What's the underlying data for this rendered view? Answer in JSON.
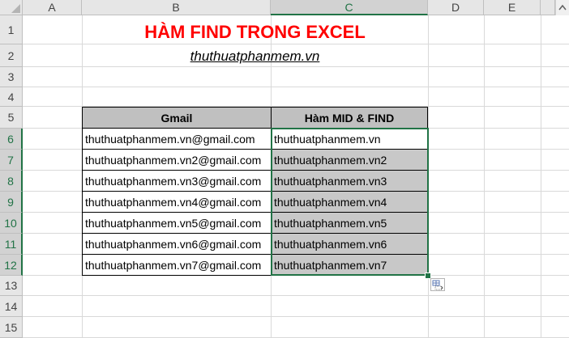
{
  "columns": [
    "A",
    "B",
    "C",
    "D",
    "E"
  ],
  "rows": [
    "1",
    "2",
    "3",
    "4",
    "5",
    "6",
    "7",
    "8",
    "9",
    "10",
    "11",
    "12",
    "13",
    "14",
    "15"
  ],
  "title": "HÀM FIND TRONG EXCEL",
  "subtitle": "thuthuatphanmem.vn",
  "table": {
    "headers": [
      "Gmail",
      "Hàm MID & FIND"
    ],
    "rows": [
      [
        "thuthuatphanmem.vn@gmail.com",
        "thuthuatphanmem.vn"
      ],
      [
        "thuthuatphanmem.vn2@gmail.com",
        "thuthuatphanmem.vn2"
      ],
      [
        "thuthuatphanmem.vn3@gmail.com",
        "thuthuatphanmem.vn3"
      ],
      [
        "thuthuatphanmem.vn4@gmail.com",
        "thuthuatphanmem.vn4"
      ],
      [
        "thuthuatphanmem.vn5@gmail.com",
        "thuthuatphanmem.vn5"
      ],
      [
        "thuthuatphanmem.vn6@gmail.com",
        "thuthuatphanmem.vn6"
      ],
      [
        "thuthuatphanmem.vn7@gmail.com",
        "thuthuatphanmem.vn7"
      ]
    ]
  },
  "selection": {
    "range": "C6:C12",
    "active_cell": "C6"
  },
  "icons": {
    "autofill": "auto-fill-options-icon",
    "scroll": "scroll-up-arrow-icon"
  },
  "colors": {
    "accent": "#217346",
    "title": "#ff0000",
    "header_fill": "#c0c0c0",
    "selection_fill": "#c8c8c8"
  }
}
